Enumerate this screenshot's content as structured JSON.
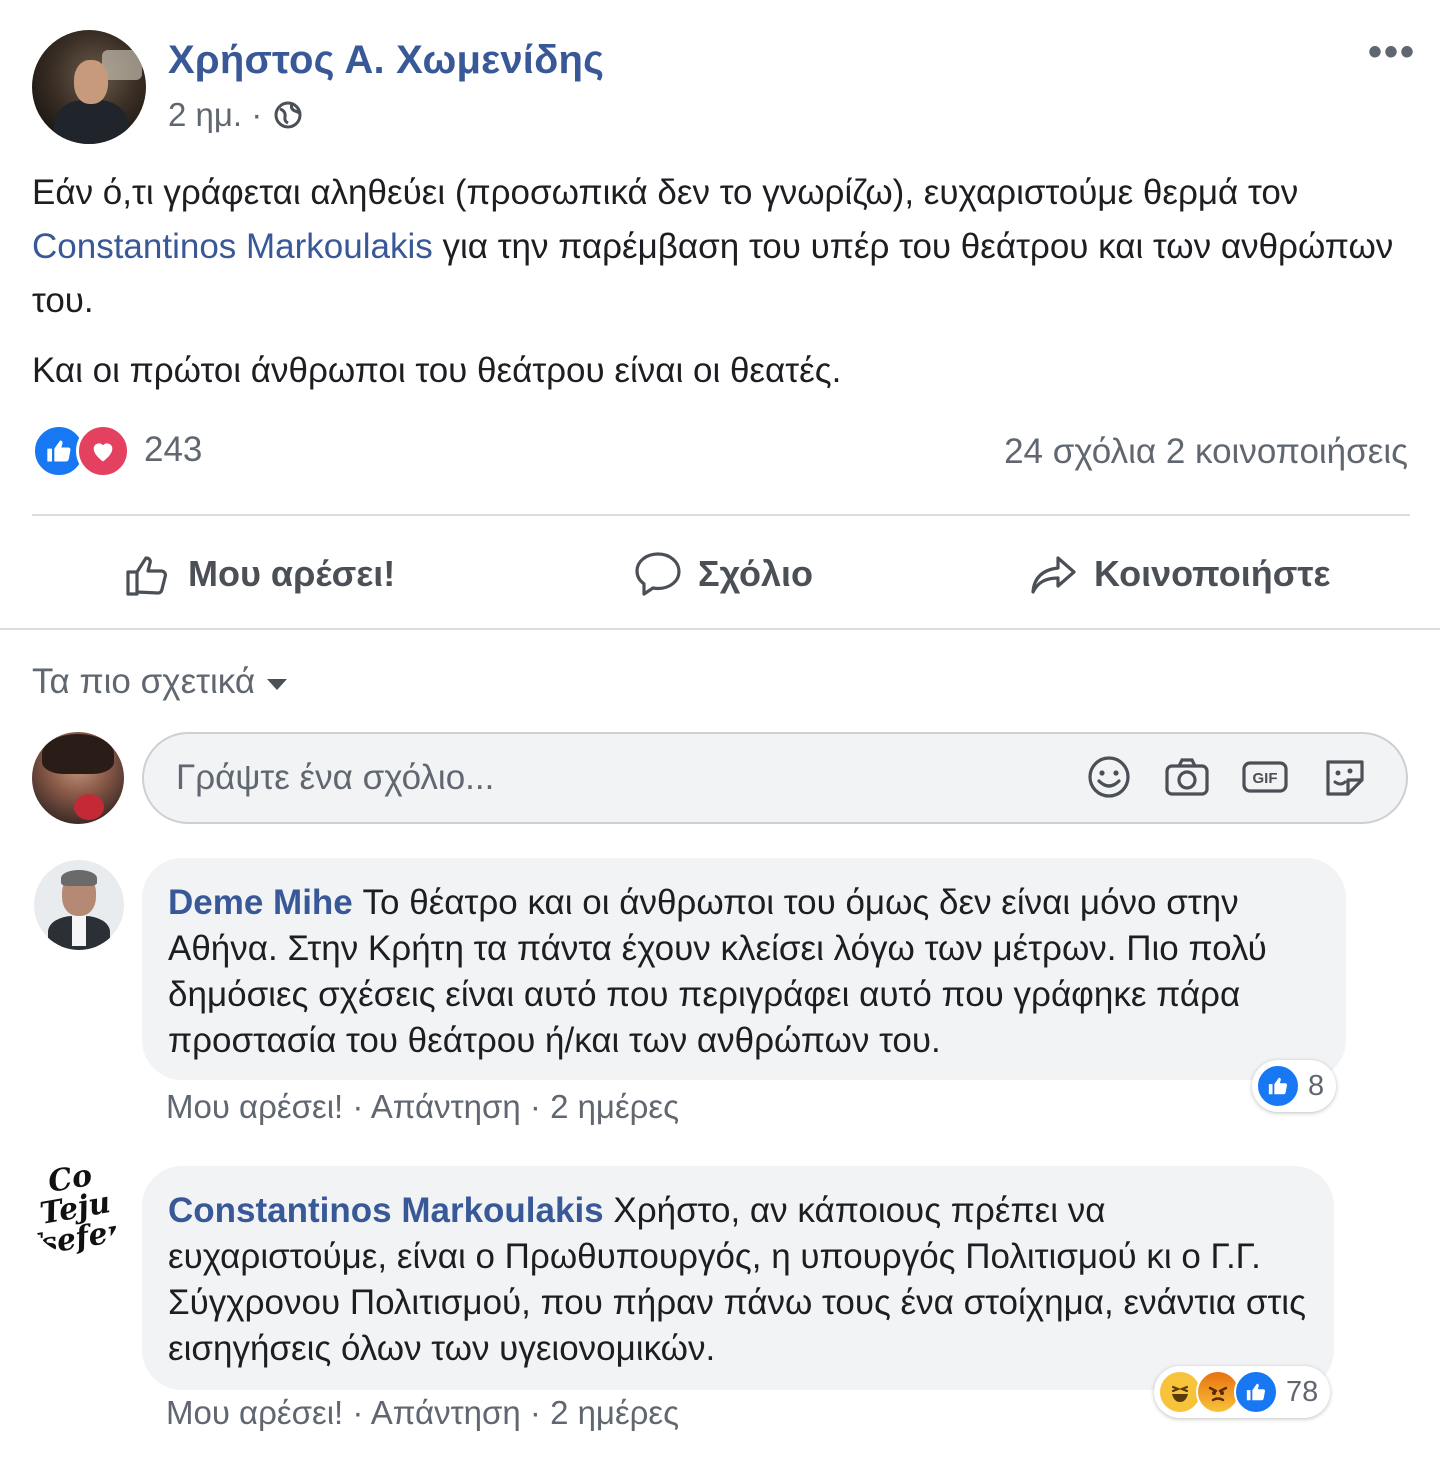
{
  "post": {
    "author": "Χρήστος Α. Χωμενίδης",
    "time": "2 ημ. ·",
    "more_label": "•••",
    "text_before_link": "Εάν ό,τι γράφεται αληθεύει (προσωπικά δεν το γνωρίζω), ευχαριστούμε θερμά τον ",
    "link_text": "Constantinos Markoulakis",
    "text_after_link": " για την παρέμβαση του υπέρ του θεάτρου και των ανθρώπων του.",
    "paragraph2": "Και οι πρώτοι άνθρωποι του θεάτρου είναι οι θεατές.",
    "reactions_count": "243",
    "comments_shares": "24 σχόλια  2 κοινοποιήσεις"
  },
  "actions": {
    "like": "Μου αρέσει!",
    "comment": "Σχόλιο",
    "share": "Κοινοποιήστε"
  },
  "sort": {
    "label": "Τα πιο σχετικά"
  },
  "composer": {
    "placeholder": "Γράψτε ένα σχόλιο..."
  },
  "comments": [
    {
      "author": "Deme Mihe",
      "text": " Το θέατρο και οι άνθρωποι του όμως δεν είναι μόνο στην Αθήνα. Στην Κρήτη τα πάντα έχουν κλείσει λόγω των μέτρων. Πιο πολύ δημόσιες σχέσεις είναι αυτό που περιγράφει αυτό που γράφηκε πάρα προστασία του θεάτρου ή/και των ανθρώπων του.",
      "reaction_count": "8",
      "like": "Μου αρέσει!",
      "reply": "Απάντηση",
      "time": "2 ημέρες"
    },
    {
      "author": "Constantinos Markoulakis",
      "text": " Χρήστο, αν κάποιους πρέπει να ευχαριστούμε, είναι ο Πρωθυπουργός, η υπουργός Πολιτισμού κι ο Γ.Γ. Σύγχρονου Πολιτισμού, που πήραν πάνω τους ένα στοίχημα, ενάντια στις εισηγήσεις όλων των υγειονομικών.",
      "reaction_count": "78",
      "like": "Μου αρέσει!",
      "reply": "Απάντηση",
      "time": "2 ημέρες",
      "avatar_logo": "Co Teju Tsefeni"
    }
  ],
  "colors": {
    "link": "#385898",
    "like_blue": "#1877f2",
    "love_red": "#e4405f",
    "secondary_text": "#606770",
    "bubble_bg": "#f2f3f5"
  }
}
